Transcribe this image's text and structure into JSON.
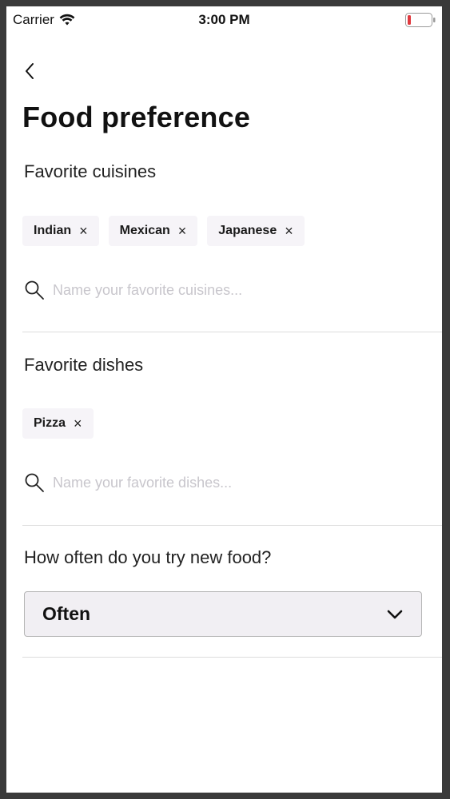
{
  "status_bar": {
    "carrier": "Carrier",
    "time": "3:00 PM",
    "battery_color": "#e0393e"
  },
  "header": {
    "back_icon": "chevron-left-icon",
    "title": "Food preference"
  },
  "cuisines": {
    "label": "Favorite cuisines",
    "chips": [
      {
        "label": "Indian",
        "remove": "×"
      },
      {
        "label": "Mexican",
        "remove": "×"
      },
      {
        "label": "Japanese",
        "remove": "×"
      }
    ],
    "search_placeholder": "Name your favorite cuisines...",
    "search_value": ""
  },
  "dishes": {
    "label": "Favorite dishes",
    "chips": [
      {
        "label": "Pizza",
        "remove": "×"
      }
    ],
    "search_placeholder": "Name your favorite dishes...",
    "search_value": ""
  },
  "frequency": {
    "label": "How often do you try new food?",
    "selected": "Often"
  }
}
